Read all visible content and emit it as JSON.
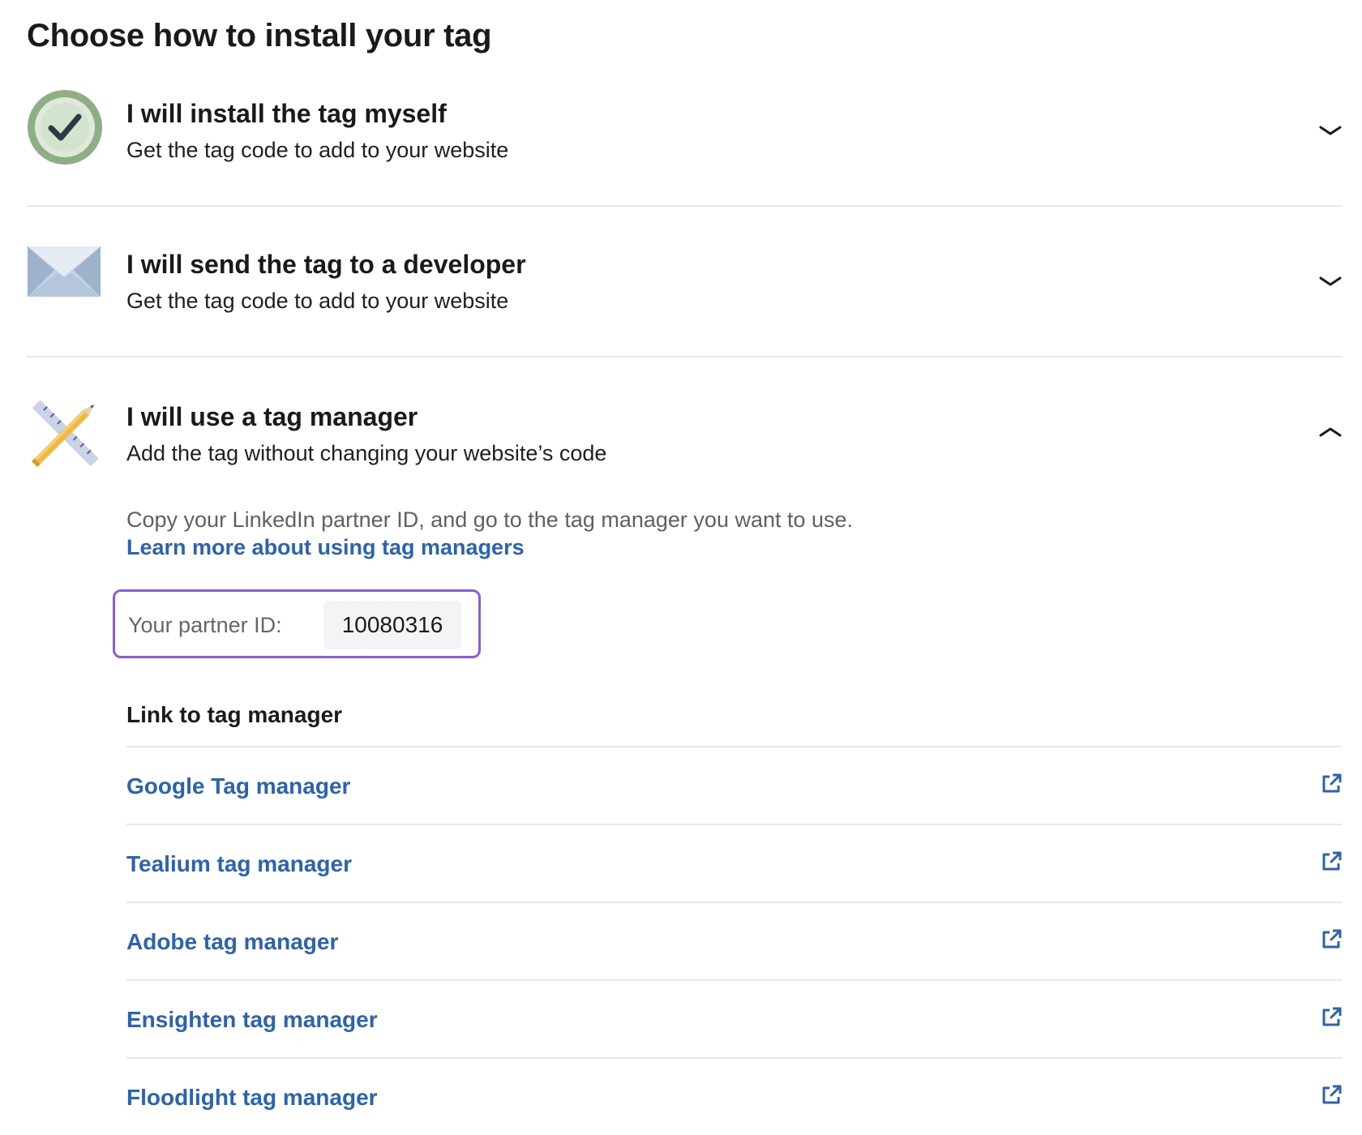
{
  "page": {
    "title": "Choose how to install your tag"
  },
  "options": [
    {
      "title": "I will install the tag myself",
      "subtitle": "Get the tag code to add to your website",
      "icon": "check-circle-icon",
      "expanded": false
    },
    {
      "title": "I will send the tag to a developer",
      "subtitle": "Get the tag code to add to your website",
      "icon": "envelope-icon",
      "expanded": false
    },
    {
      "title": "I will use a tag manager",
      "subtitle": "Add the tag without changing your website’s code",
      "icon": "ruler-pencil-icon",
      "expanded": true
    }
  ],
  "tag_manager_panel": {
    "description": "Copy your LinkedIn partner ID, and go to the tag manager you want to use.",
    "learn_more_link": "Learn more about using tag managers",
    "partner_id_label": "Your partner ID:",
    "partner_id_value": "10080316",
    "link_heading": "Link to tag manager",
    "managers": [
      {
        "label": "Google Tag manager",
        "icon": "external-link-icon"
      },
      {
        "label": "Tealium tag manager",
        "icon": "external-link-icon"
      },
      {
        "label": "Adobe tag manager",
        "icon": "external-link-icon"
      },
      {
        "label": "Ensighten tag manager",
        "icon": "external-link-icon"
      },
      {
        "label": "Floodlight tag manager",
        "icon": "external-link-icon"
      }
    ]
  },
  "colors": {
    "link": "#2a64b0",
    "highlight_border": "#8a5ce0",
    "check_green": "#8fae86"
  }
}
